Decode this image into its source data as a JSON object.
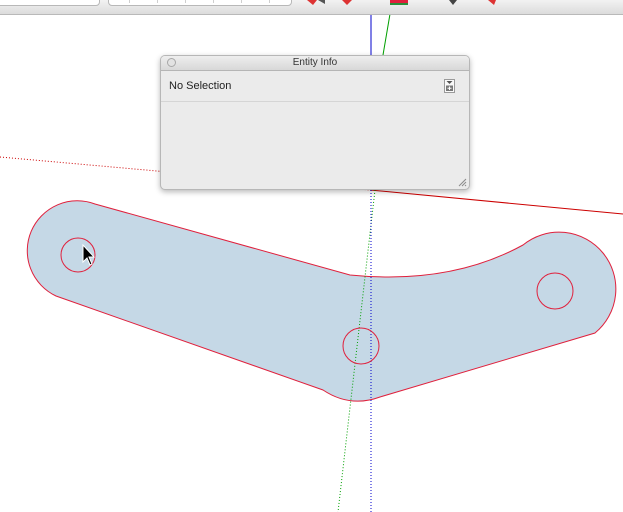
{
  "toolbar": {
    "icons": [
      "arrow-tool-icon",
      "paint-tool-icon",
      "tape-measure-icon",
      "orbit-icon",
      "walk-icon"
    ]
  },
  "entity_info": {
    "title": "Entity Info",
    "selection_label": "No Selection",
    "icons": [
      "close-icon",
      "expand-toggle-icon",
      "resize-grip-icon"
    ]
  },
  "model": {
    "face_fill": "#c5d8e6",
    "edge_color": "#e0203c",
    "axis_red": "#cc0000",
    "axis_green": "#00a000",
    "axis_blue": "#0000cc",
    "hole_count": 3
  }
}
